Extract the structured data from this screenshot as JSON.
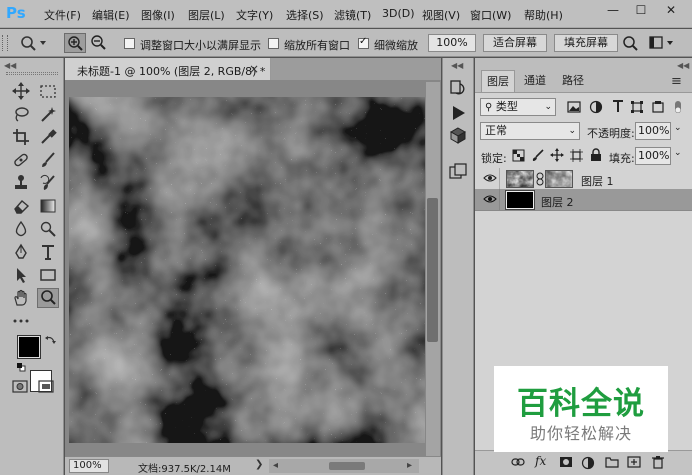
{
  "app": {
    "logo": "Ps"
  },
  "menu": [
    "文件(F)",
    "编辑(E)",
    "图像(I)",
    "图层(L)",
    "文字(Y)",
    "选择(S)",
    "滤镜(T)",
    "3D(D)",
    "视图(V)",
    "窗口(W)",
    "帮助(H)"
  ],
  "window_controls": {
    "min": "—",
    "max": "☐",
    "close": "✕"
  },
  "options": {
    "resize_windows_label": "调整窗口大小以满屏显示",
    "zoom_all_label": "缩放所有窗口",
    "scrubby_zoom_label": "细微缩放",
    "zoom_value": "100%",
    "fit_screen": "适合屏幕",
    "fill_screen": "填充屏幕"
  },
  "document": {
    "tab_title": "未标题-1 @ 100% (图层 2, RGB/8) *",
    "close_glyph": "×",
    "zoom": "100%",
    "doc_info": "文档:937.5K/2.14M"
  },
  "layers_panel": {
    "tabs": [
      "图层",
      "通道",
      "路径"
    ],
    "kind_filter": "类型",
    "blend_mode": "正常",
    "opacity_label": "不透明度:",
    "opacity_value": "100%",
    "lock_label": "锁定:",
    "fill_label": "填充:",
    "fill_value": "100%",
    "layers": [
      {
        "name": "图层 1",
        "visible": true,
        "selected": false
      },
      {
        "name": "图层 2",
        "visible": true,
        "selected": true
      }
    ],
    "footer_fx": "fx"
  },
  "watermark": {
    "title": "百科全说",
    "subtitle": "助你轻松解决"
  },
  "colors": {
    "accent": "#31a8ff",
    "panel_bg": "#bdbdbd",
    "selected_layer": "#999999",
    "watermark_green": "#1f9d3f"
  }
}
